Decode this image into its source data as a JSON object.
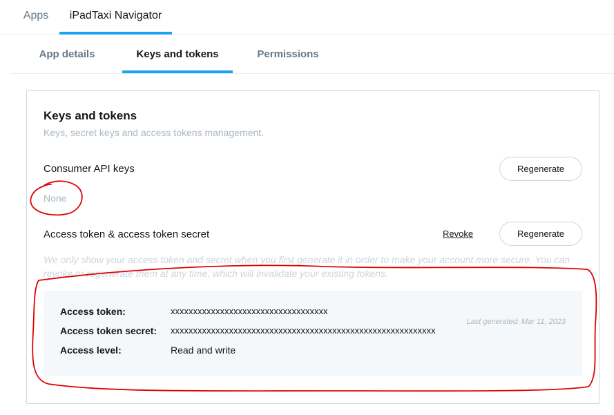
{
  "top_nav": {
    "apps_label": "Apps",
    "app_name": "iPadTaxi Navigator"
  },
  "sub_nav": {
    "tabs": [
      {
        "label": "App details",
        "active": false
      },
      {
        "label": "Keys and tokens",
        "active": true
      },
      {
        "label": "Permissions",
        "active": false
      }
    ]
  },
  "card": {
    "title": "Keys and tokens",
    "subtitle": "Keys, secret keys and access tokens management."
  },
  "consumer": {
    "title": "Consumer API keys",
    "value": "None",
    "regenerate_label": "Regenerate"
  },
  "access": {
    "title": "Access token & access token secret",
    "revoke_label": "Revoke",
    "regenerate_label": "Regenerate",
    "help_text": "We only show your access token and secret when you first generate it in order to make your account more secure. You can revoke or regenerate them at any time, which will invalidate your existing tokens.",
    "rows": [
      {
        "label": "Access token:",
        "value": "xxxxxxxxxxxxxxxxxxxxxxxxxxxxxxxxxxx"
      },
      {
        "label": "Access token secret:",
        "value": "xxxxxxxxxxxxxxxxxxxxxxxxxxxxxxxxxxxxxxxxxxxxxxxxxxxxxxxxxxx"
      },
      {
        "label": "Access level:",
        "value": "Read and write"
      }
    ],
    "last_generated": "Last generated: Mar 11, 2023"
  },
  "colors": {
    "accent": "#1da1f2",
    "annotation": "#e00000",
    "muted_text": "#aab8c2"
  }
}
